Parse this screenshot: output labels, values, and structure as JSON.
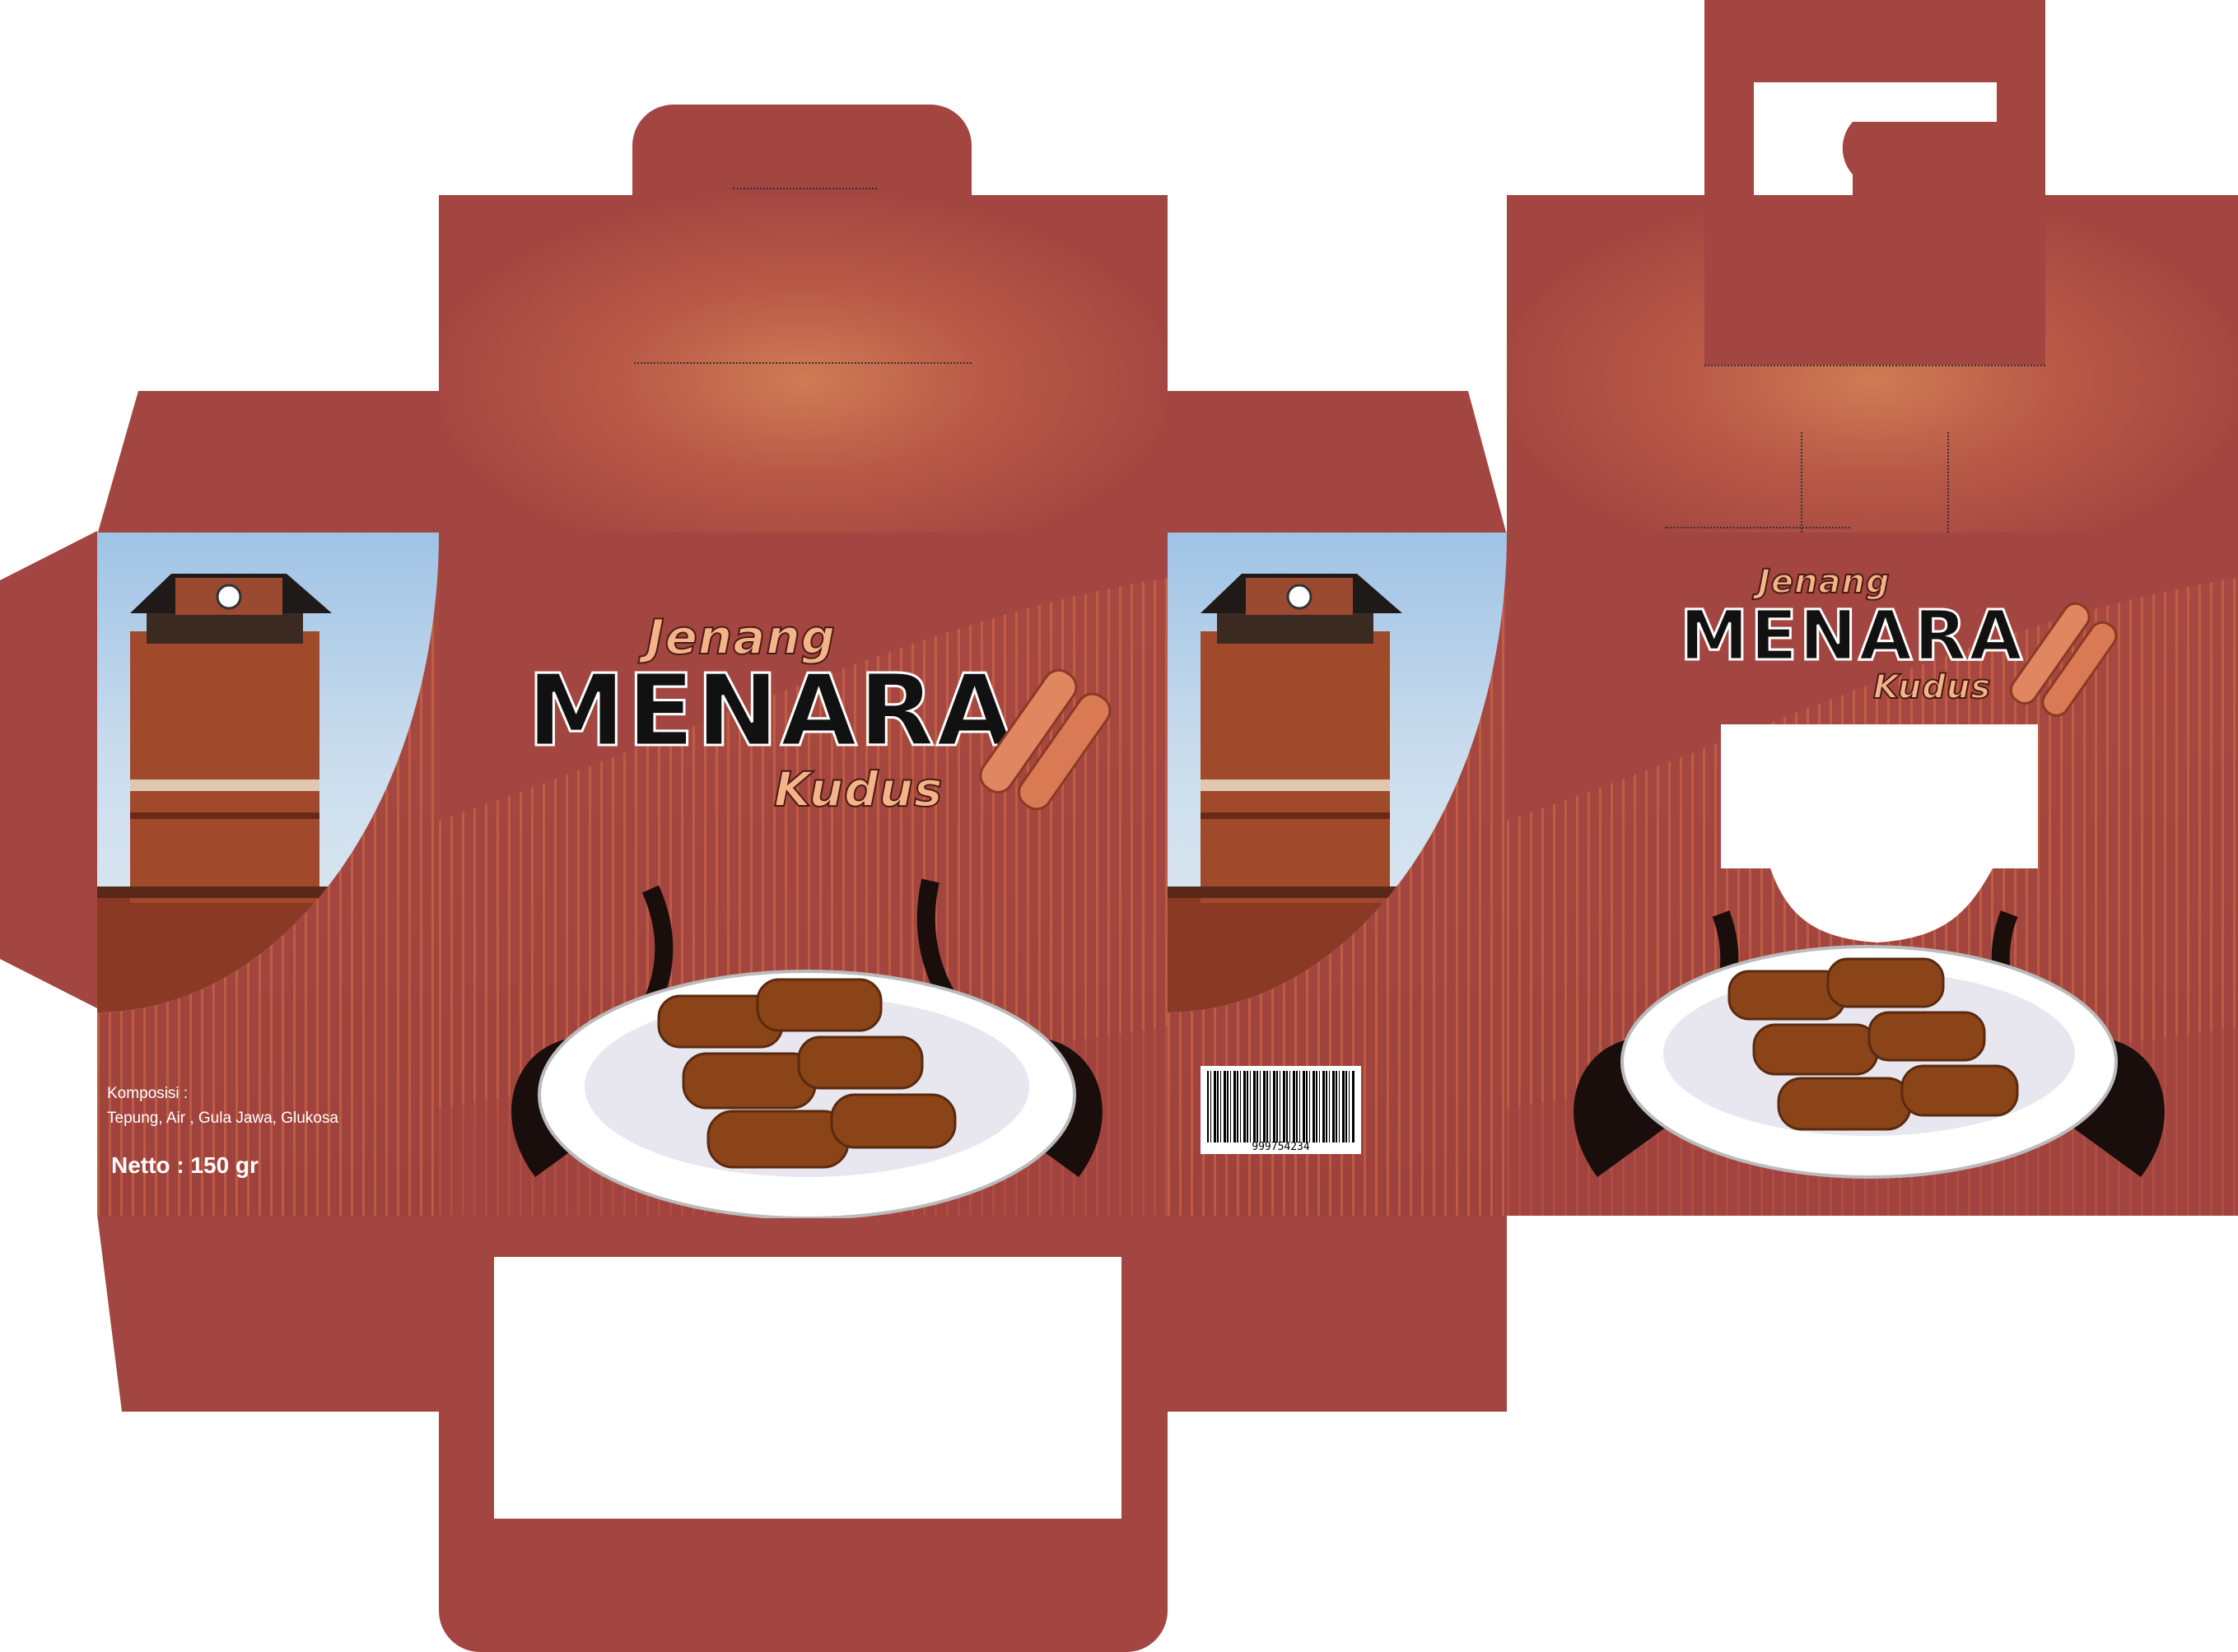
{
  "front": {
    "logo_top": "Jenang",
    "logo_main": "MENARA",
    "logo_sub": "Kudus"
  },
  "back": {
    "logo_top": "Jenang",
    "logo_main": "MENARA",
    "logo_sub": "Kudus"
  },
  "side": {
    "composition_label": "Komposisi :",
    "composition_value": "Tepung, Air , Gula Jawa, Glukosa",
    "net_weight": "Netto : 150 gr"
  },
  "barcode": {
    "number": "999754234"
  },
  "colors": {
    "box_brown": "#a34540",
    "highlight": "#cf7c55",
    "stripe": "#d66e46"
  }
}
